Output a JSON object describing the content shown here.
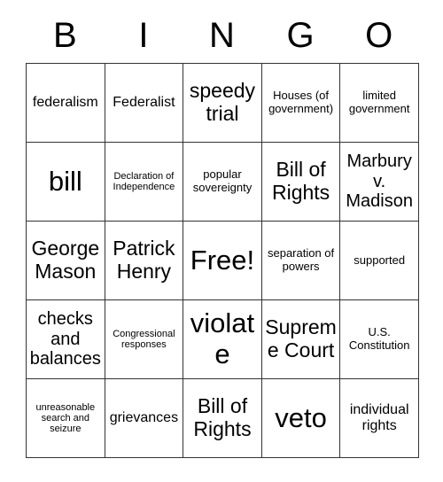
{
  "card": {
    "title": "BINGO",
    "header_letters": [
      "B",
      "I",
      "N",
      "G",
      "O"
    ],
    "free_space_label": "Free!",
    "colors": {
      "background": "#ffffff",
      "text": "#000000",
      "border": "#333333"
    },
    "grid": {
      "columns": 5,
      "rows": 5,
      "cells": [
        [
          {
            "text": "federalism",
            "size": "md"
          },
          {
            "text": "Federalist",
            "size": "md"
          },
          {
            "text": "speedy trial",
            "size": "xl"
          },
          {
            "text": "Houses (of government)",
            "size": "sm"
          },
          {
            "text": "limited government",
            "size": "sm"
          }
        ],
        [
          {
            "text": "bill",
            "size": "xxl"
          },
          {
            "text": "Declaration of Independence",
            "size": "xs"
          },
          {
            "text": "popular sovereignty",
            "size": "sm"
          },
          {
            "text": "Bill of Rights",
            "size": "xl"
          },
          {
            "text": "Marbury v. Madison",
            "size": "lg"
          }
        ],
        [
          {
            "text": "George Mason",
            "size": "xl"
          },
          {
            "text": "Patrick Henry",
            "size": "xl"
          },
          {
            "text": "Free!",
            "size": "xxl"
          },
          {
            "text": "separation of powers",
            "size": "sm"
          },
          {
            "text": "supported",
            "size": "sm"
          }
        ],
        [
          {
            "text": "checks and balances",
            "size": "lg"
          },
          {
            "text": "Congressional responses",
            "size": "xs"
          },
          {
            "text": "violate",
            "size": "xxl"
          },
          {
            "text": "Supreme Court",
            "size": "xl"
          },
          {
            "text": "U.S. Constitution",
            "size": "sm"
          }
        ],
        [
          {
            "text": "unreasonable search and seizure",
            "size": "xs"
          },
          {
            "text": "grievances",
            "size": "md"
          },
          {
            "text": "Bill of Rights",
            "size": "xl"
          },
          {
            "text": "veto",
            "size": "xxl"
          },
          {
            "text": "individual rights",
            "size": "md"
          }
        ]
      ]
    }
  }
}
